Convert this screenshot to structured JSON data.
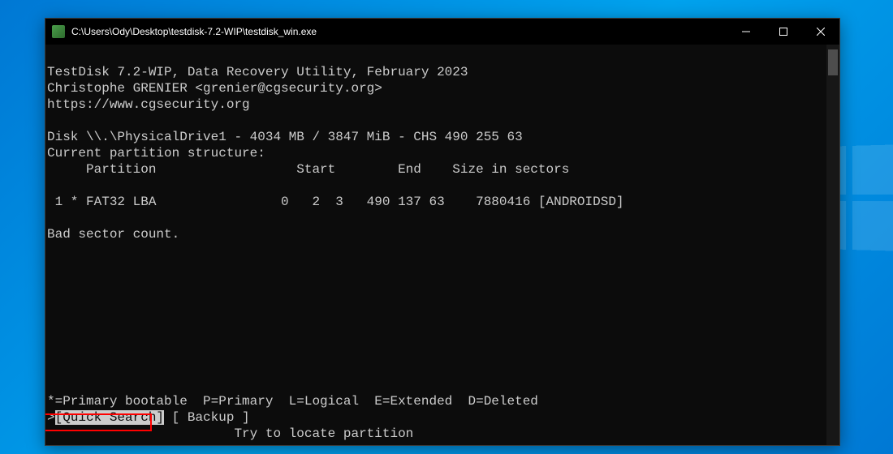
{
  "titlebar": {
    "path": "C:\\Users\\Ody\\Desktop\\testdisk-7.2-WIP\\testdisk_win.exe"
  },
  "header": {
    "line1": "TestDisk 7.2-WIP, Data Recovery Utility, February 2023",
    "line2": "Christophe GRENIER <grenier@cgsecurity.org>",
    "line3": "https://www.cgsecurity.org"
  },
  "disk": {
    "info": "Disk \\\\.\\PhysicalDrive1 - 4034 MB / 3847 MiB - CHS 490 255 63",
    "structure_label": "Current partition structure:",
    "columns": "     Partition                  Start        End    Size in sectors",
    "row1": " 1 * FAT32 LBA                0   2  3   490 137 63    7880416 [ANDROIDSD]"
  },
  "status": {
    "bad_sector": "Bad sector count."
  },
  "legend": {
    "line": "*=Primary bootable  P=Primary  L=Logical  E=Extended  D=Deleted"
  },
  "menu": {
    "cursor": ">",
    "quick_search": "[Quick Search]",
    "backup": " [ Backup ]",
    "hint": "                        Try to locate partition"
  }
}
